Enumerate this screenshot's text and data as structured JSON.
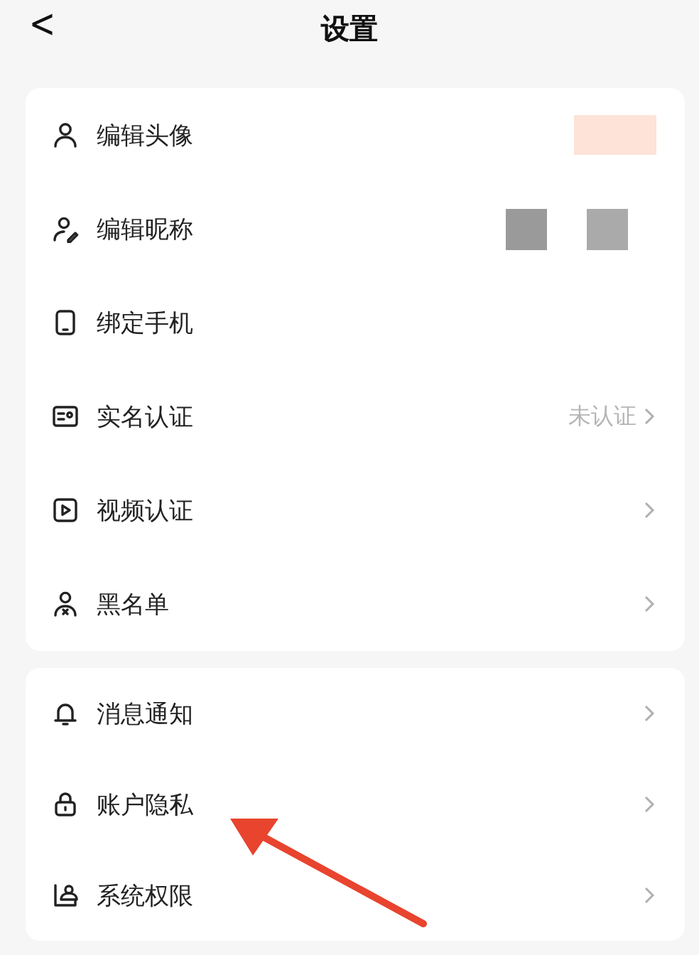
{
  "header": {
    "back": "<",
    "title": "设置"
  },
  "sections": [
    {
      "rows": [
        {
          "label": "编辑头像",
          "kind": "avatar"
        },
        {
          "label": "编辑昵称",
          "kind": "nickname"
        },
        {
          "label": "绑定手机",
          "kind": "plain"
        },
        {
          "label": "实名认证",
          "kind": "link",
          "value": "未认证"
        },
        {
          "label": "视频认证",
          "kind": "link"
        },
        {
          "label": "黑名单",
          "kind": "link"
        }
      ]
    },
    {
      "rows": [
        {
          "label": "消息通知",
          "kind": "link"
        },
        {
          "label": "账户隐私",
          "kind": "link"
        },
        {
          "label": "系统权限",
          "kind": "link"
        }
      ]
    }
  ]
}
